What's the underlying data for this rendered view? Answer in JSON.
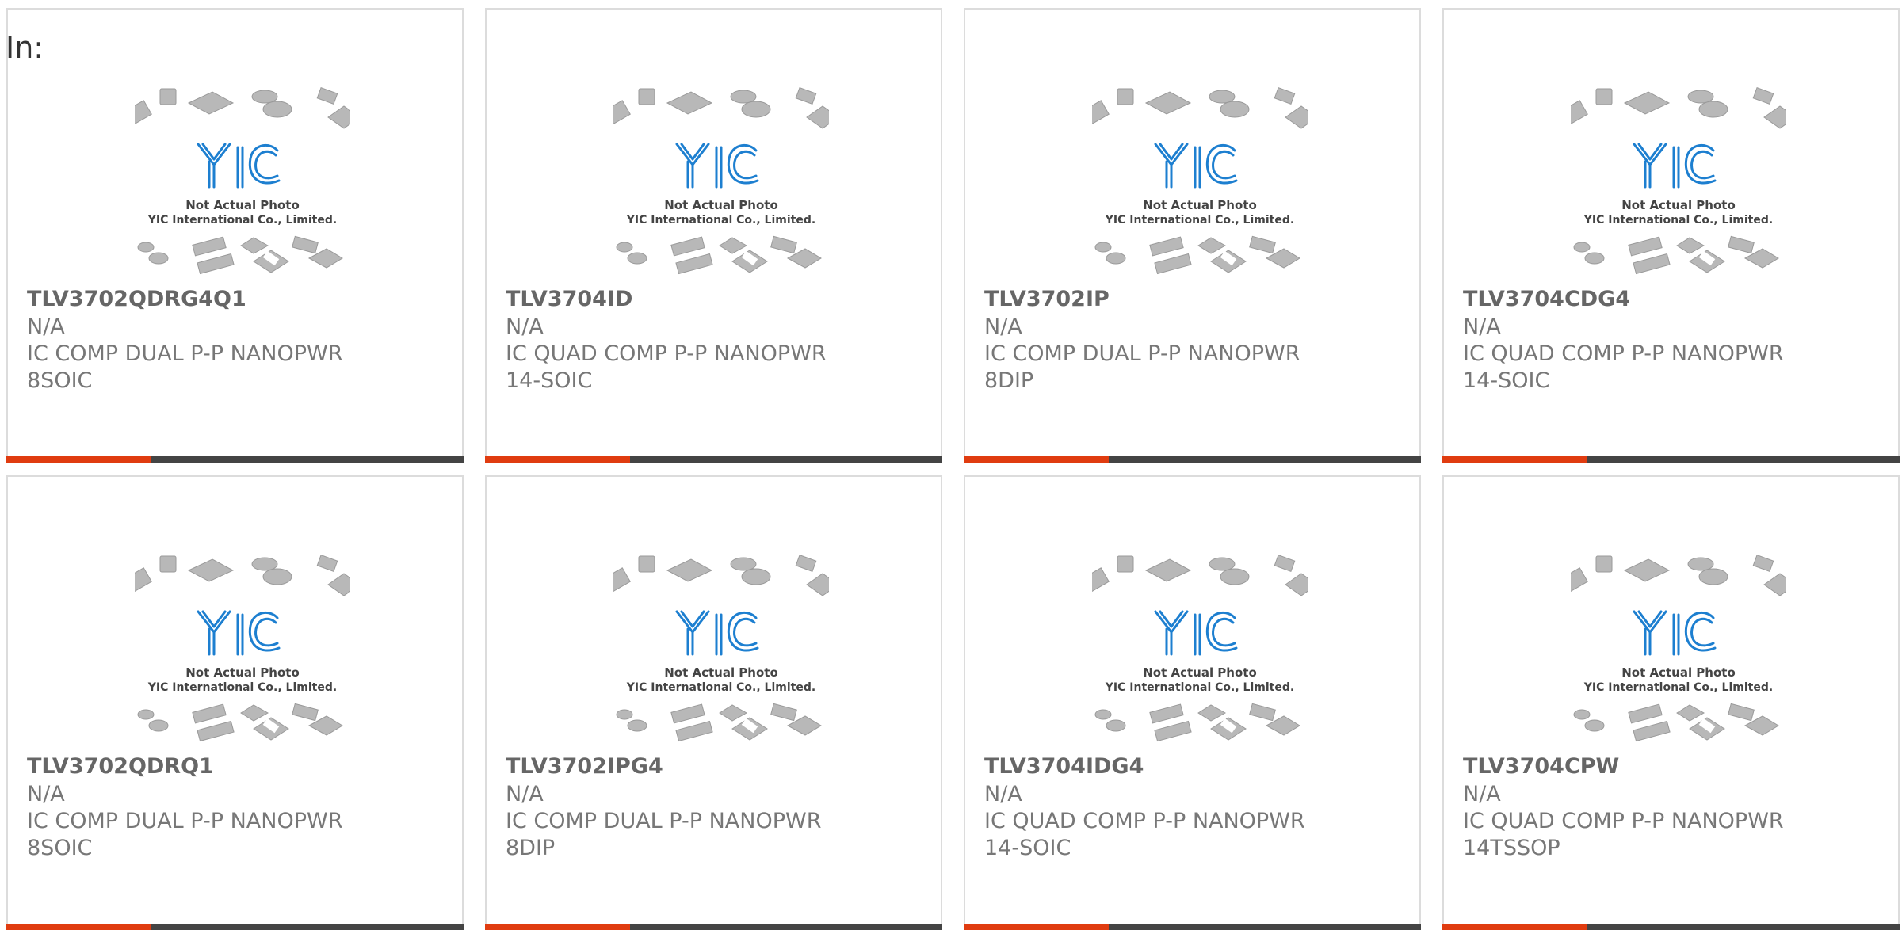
{
  "header": {
    "label": "In:"
  },
  "placeholder": {
    "brand": "YIC",
    "line1": "Not Actual Photo",
    "line2": "YIC International Co., Limited."
  },
  "colors": {
    "accent": "#e03c10",
    "bar": "#444444",
    "brand_blue": "#1d7fd0"
  },
  "products": [
    {
      "part": "TLV3702QDRG4Q1",
      "mfr": "N/A",
      "desc1": "IC COMP DUAL P-P NANOPWR",
      "desc2": "8SOIC"
    },
    {
      "part": "TLV3704ID",
      "mfr": "N/A",
      "desc1": "IC QUAD COMP P-P NANOPWR",
      "desc2": "14-SOIC"
    },
    {
      "part": "TLV3702IP",
      "mfr": "N/A",
      "desc1": "IC COMP DUAL P-P NANOPWR",
      "desc2": "8DIP"
    },
    {
      "part": "TLV3704CDG4",
      "mfr": "N/A",
      "desc1": "IC QUAD COMP P-P NANOPWR",
      "desc2": "14-SOIC"
    },
    {
      "part": "TLV3702QDRQ1",
      "mfr": "N/A",
      "desc1": "IC COMP DUAL P-P NANOPWR",
      "desc2": "8SOIC"
    },
    {
      "part": "TLV3702IPG4",
      "mfr": "N/A",
      "desc1": "IC COMP DUAL P-P NANOPWR",
      "desc2": "8DIP"
    },
    {
      "part": "TLV3704IDG4",
      "mfr": "N/A",
      "desc1": "IC QUAD COMP P-P NANOPWR",
      "desc2": "14-SOIC"
    },
    {
      "part": "TLV3704CPW",
      "mfr": "N/A",
      "desc1": "IC QUAD COMP P-P NANOPWR",
      "desc2": "14TSSOP"
    }
  ]
}
